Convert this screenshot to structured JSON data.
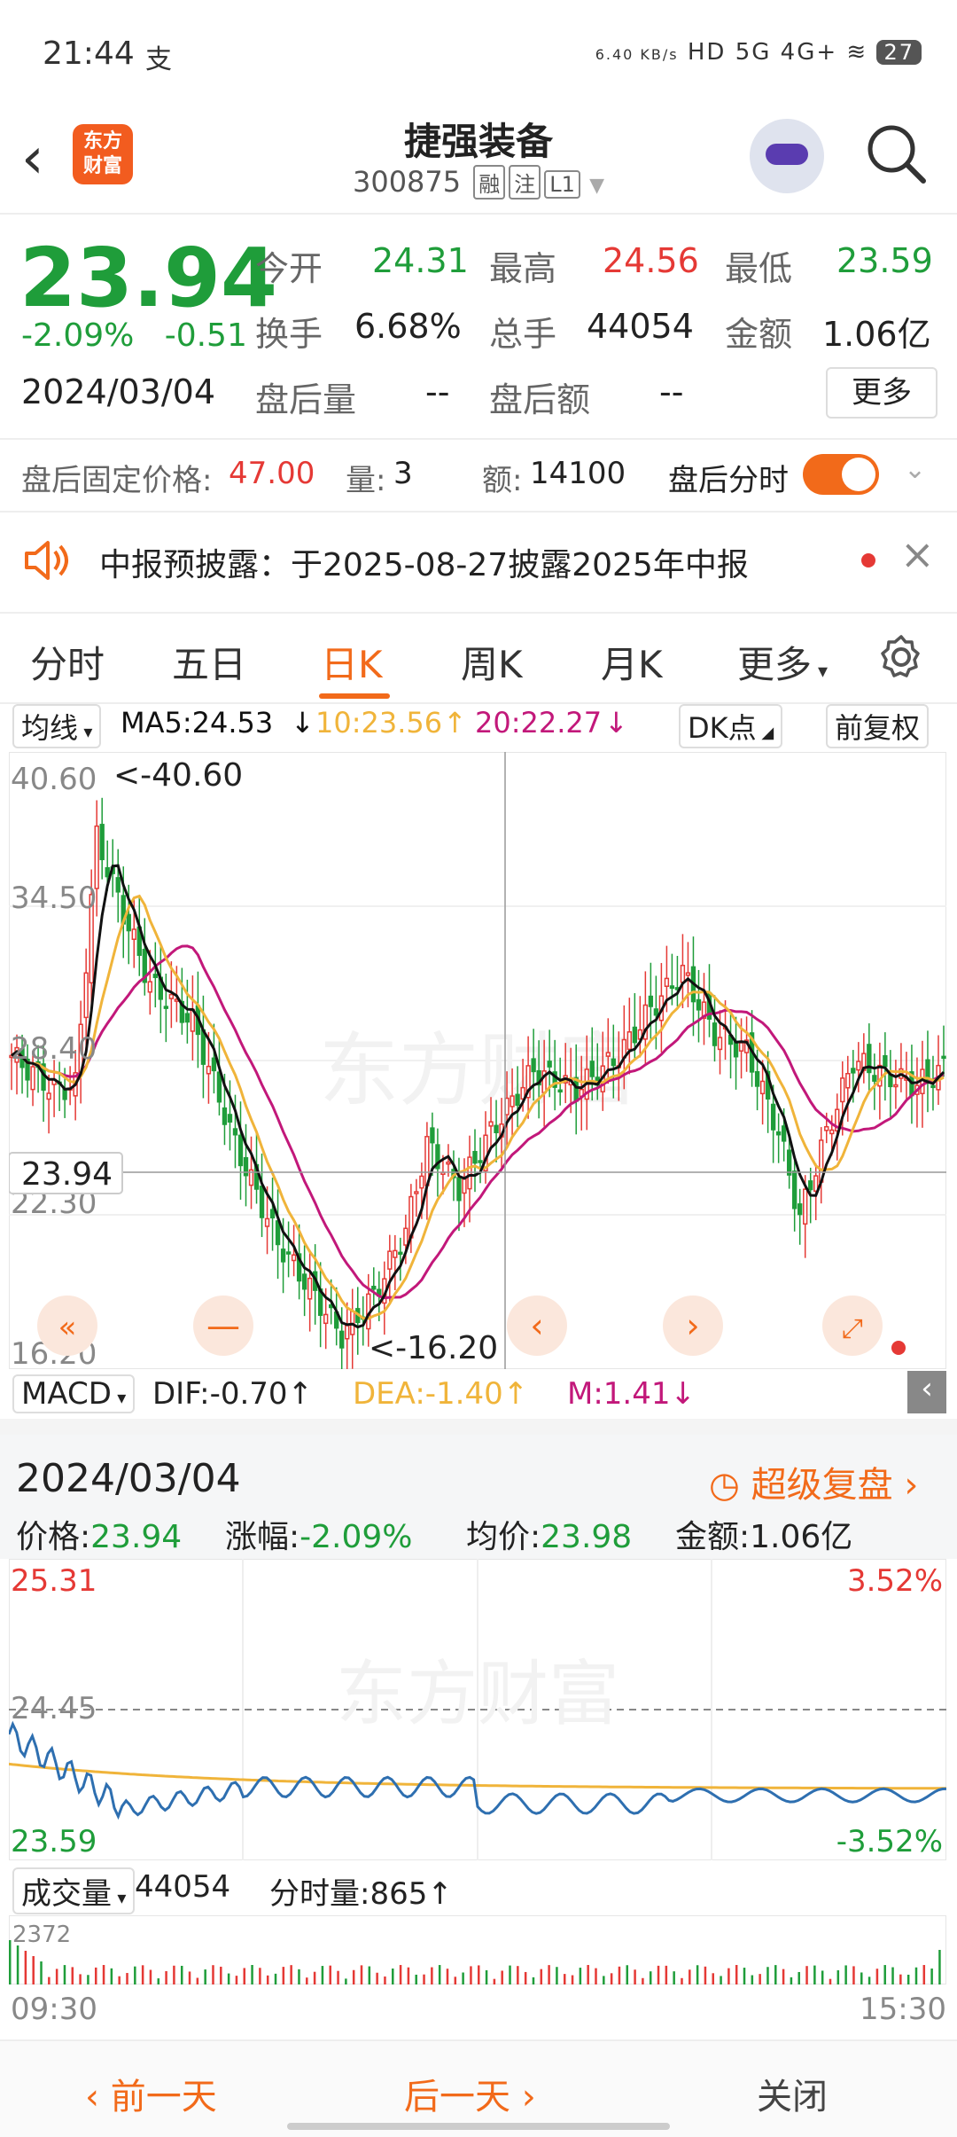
{
  "status": {
    "time": "21:44",
    "pay_icon": "支",
    "speed": "6.40 KB/s",
    "signals": "HD 5G 4G+",
    "battery": "27"
  },
  "header": {
    "title": "捷强装备",
    "code": "300875",
    "tags": [
      "融",
      "注",
      "L1"
    ],
    "logo_text": "东方\n财富"
  },
  "quote": {
    "price": "23.94",
    "change_pct": "-2.09%",
    "change": "-0.51",
    "date": "2024/03/04",
    "open_label": "今开",
    "open": "24.31",
    "high_label": "最高",
    "high": "24.56",
    "low_label": "最低",
    "low": "23.59",
    "turnover_label": "换手",
    "turnover": "6.68%",
    "volume_label": "总手",
    "volume": "44054",
    "amount_label": "金额",
    "amount": "1.06亿",
    "after_vol_label": "盘后量",
    "after_vol": "--",
    "after_amt_label": "盘后额",
    "after_amt": "--",
    "more": "更多"
  },
  "afterhours": {
    "price_label": "盘后固定价格:",
    "price": "47.00",
    "vol_label": "量:",
    "vol": "3",
    "amt_label": "额:",
    "amt": "14100",
    "toggle_label": "盘后分时"
  },
  "notice": {
    "text": "中报预披露：于2025-08-27披露2025年中报"
  },
  "tabs": [
    "分时",
    "五日",
    "日K",
    "周K",
    "月K",
    "更多"
  ],
  "kline": {
    "indicator": "均线",
    "ma5": "MA5:24.53",
    "ma10": "10:23.56",
    "ma20": "20:22.27",
    "dk": "DK点",
    "adjust": "前复权",
    "y_labels": [
      "40.60",
      "34.50",
      "28.40",
      "22.30",
      "16.20"
    ],
    "max_label": "<-40.60",
    "min_label": "<-16.20",
    "current": "23.94",
    "macd": "MACD",
    "dif": "DIF:-0.70",
    "dea": "DEA:-1.40",
    "m": "M:1.41"
  },
  "intraday": {
    "date": "2024/03/04",
    "replay": "超级复盘",
    "price_label": "价格:",
    "price": "23.94",
    "pct_label": "涨幅:",
    "pct": "-2.09%",
    "avg_label": "均价:",
    "avg": "23.98",
    "amt_label": "金额:",
    "amt": "1.06亿",
    "y_top": "25.31",
    "y_mid": "24.45",
    "y_bot": "23.59",
    "pct_top": "3.52%",
    "pct_bot": "-3.52%",
    "vol_label": "成交量",
    "vol": "44054",
    "min_vol": "分时量:865",
    "vol_max": "2372",
    "t_start": "09:30",
    "t_end": "15:30"
  },
  "watermark": "东方财富",
  "bottom": {
    "prev": "前一天",
    "next": "后一天",
    "close": "关闭"
  },
  "colors": {
    "up": "#e53935",
    "down": "#1f9d3a",
    "accent": "#f26a1a",
    "ma5": "#111111",
    "ma10": "#f0b43a",
    "ma20": "#c2187a"
  }
}
